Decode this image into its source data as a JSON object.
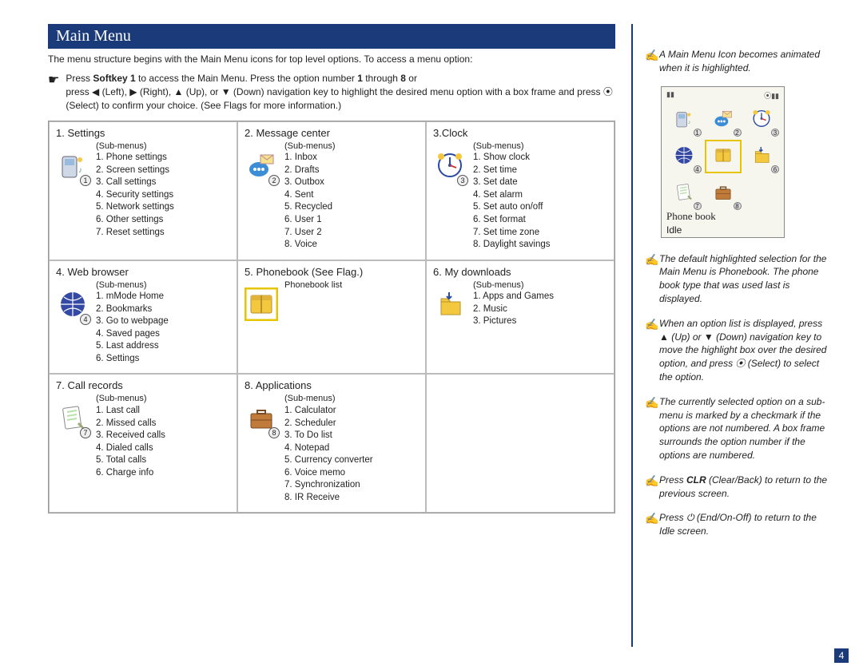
{
  "header": {
    "title": "Main Menu"
  },
  "intro": "The menu structure begins with the Main Menu icons for top level options. To access a menu option:",
  "instruction": {
    "line1_a": "Press ",
    "line1_softkey": "Softkey 1",
    "line1_b": " to access the Main Menu. Press the option number ",
    "line1_c": " through ",
    "line1_d": " or",
    "num1": "1",
    "num8": "8",
    "line2": "press ◀ (Left), ▶ (Right), ▲ (Up), or ▼ (Down) navigation key to highlight the desired menu option with a box frame and press ⦿ (Select) to confirm your choice. (See Flags for more information.)"
  },
  "subm_label": "(Sub-menus)",
  "cells": [
    {
      "title": "1. Settings",
      "icon": "settings-icon",
      "sub_label": "(Sub-menus)",
      "items": [
        "1. Phone settings",
        "2. Screen settings",
        "3. Call settings",
        "4. Security settings",
        "5. Network settings",
        "6. Other settings",
        "7. Reset settings"
      ],
      "badge": "1"
    },
    {
      "title": "2. Message center",
      "icon": "message-icon",
      "sub_label": "(Sub-menus)",
      "items": [
        "1. Inbox",
        "2. Drafts",
        "3. Outbox",
        "4. Sent",
        "5. Recycled",
        "6. User 1",
        "7. User 2",
        "8. Voice"
      ],
      "badge": "2"
    },
    {
      "title": "3.Clock",
      "icon": "clock-icon",
      "sub_label": "(Sub-menus)",
      "items": [
        "1. Show clock",
        "2. Set time",
        "3. Set date",
        "4. Set alarm",
        "5. Set auto on/off",
        "6. Set format",
        "7. Set time zone",
        "8. Daylight savings"
      ],
      "badge": "3"
    },
    {
      "title": "4. Web browser",
      "icon": "globe-icon",
      "sub_label": "(Sub-menus)",
      "items": [
        "1. mMode Home",
        "2. Bookmarks",
        "3. Go to webpage",
        "4. Saved pages",
        "5. Last address",
        "6. Settings"
      ],
      "badge": "4"
    },
    {
      "title": "5. Phonebook (See Flag.)",
      "icon": "phonebook-icon",
      "sub_label": "Phonebook list",
      "items": [],
      "badge": "",
      "highlight": true
    },
    {
      "title": "6. My downloads",
      "icon": "downloads-icon",
      "sub_label": "(Sub-menus)",
      "items": [
        "1. Apps and Games",
        "2. Music",
        "3. Pictures"
      ],
      "badge": ""
    },
    {
      "title": "7. Call records",
      "icon": "records-icon",
      "sub_label": "(Sub-menus)",
      "items": [
        "1. Last call",
        "2. Missed calls",
        "3. Received calls",
        "4. Dialed calls",
        "5. Total calls",
        "6. Charge info"
      ],
      "badge": "7"
    },
    {
      "title": "8. Applications",
      "icon": "briefcase-icon",
      "sub_label": "(Sub-menus)",
      "items": [
        "1. Calculator",
        "2. Scheduler",
        "3. To Do list",
        "4. Notepad",
        "5. Currency converter",
        "6. Voice memo",
        "7. Synchronization",
        "8. IR Receive"
      ],
      "badge": "8"
    },
    {
      "title": "",
      "icon": "",
      "sub_label": "",
      "items": [],
      "badge": ""
    }
  ],
  "side_notes": [
    "A Main Menu Icon becomes animated when it is highlighted.",
    "The default highlighted selection for the Main Menu is Phonebook. The phone book type that was used last is displayed.",
    "When an option list is displayed, press ▲ (Up) or ▼ (Down) navigation key to move the highlight box over the desired option, and press ⦿ (Select) to select the option.",
    "The currently selected option on a sub-menu is marked by a checkmark if the options are not numbered. A box frame surrounds the option number if the options are numbered.",
    "Press CLR (Clear/Back) to return to the previous screen.",
    "Press ⏻ (End/On-Off) to return to the Idle screen."
  ],
  "side_note_5": {
    "a": "Press ",
    "b": "CLR",
    "c": " (Clear/Back) to return to the previous screen."
  },
  "phone": {
    "label": "Phone book",
    "idle": "Idle",
    "badges": [
      "1",
      "2",
      "3",
      "4",
      "",
      "6",
      "7",
      "8"
    ]
  },
  "page_number": "4"
}
